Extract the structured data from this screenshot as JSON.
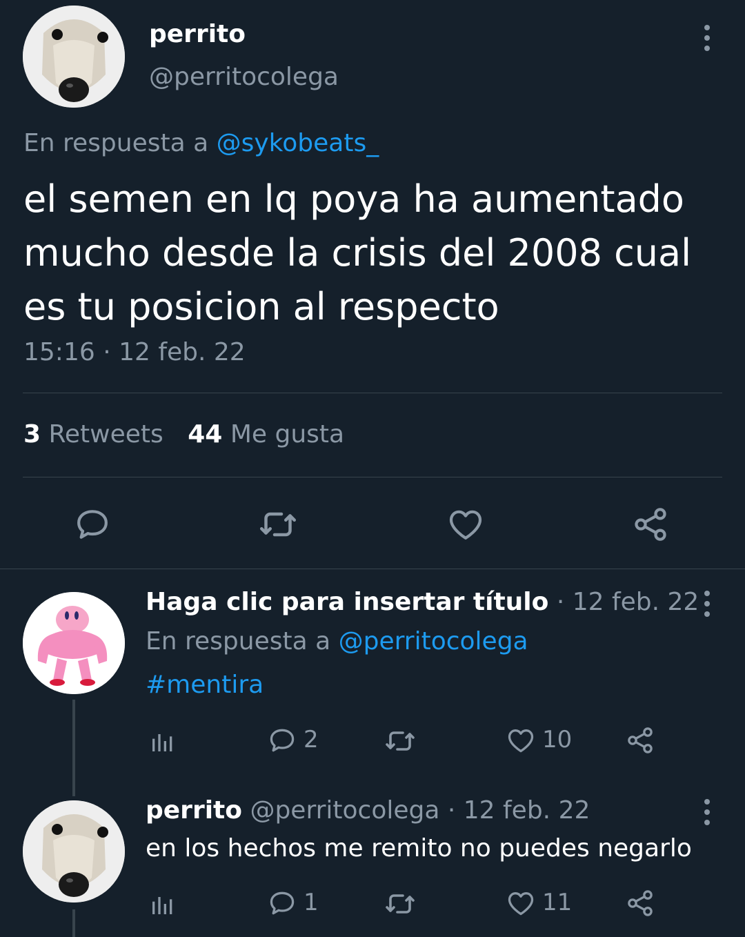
{
  "main_tweet": {
    "display_name": "perrito",
    "handle": "@perritocolega",
    "reply_prefix": "En respuesta a",
    "reply_to": "@sykobeats_",
    "text_lines": [
      "el semen en lq poya ha aumentado",
      "mucho desde la crisis del 2008 cual",
      "es tu posicion al respecto"
    ],
    "timestamp": "15:16 · 12 feb. 22",
    "retweets_count": "3",
    "retweets_label": "Retweets",
    "likes_count": "44",
    "likes_label": "Me gusta",
    "icons": [
      "reply-icon",
      "retweet-icon",
      "like-icon",
      "share-icon"
    ]
  },
  "replies": [
    {
      "display_name": "Haga clic para insertar título",
      "date": "· 12 feb. 22",
      "reply_prefix": "En respuesta a",
      "reply_to": "@perritocolega",
      "text": "#mentira",
      "reply_count": "2",
      "like_count": "10"
    },
    {
      "display_name": "perrito",
      "handle_date": "@perritocolega · 12 feb. 22",
      "text": "en los hechos me remito no puedes negarlo",
      "reply_count": "1",
      "like_count": "11"
    }
  ],
  "colors": {
    "background": "#15202b",
    "accent": "#1d9bf0",
    "muted": "#8b98a5",
    "divider": "#38444d"
  }
}
